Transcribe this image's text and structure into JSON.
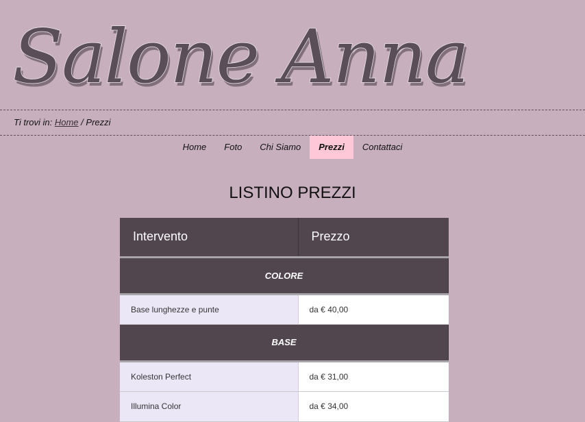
{
  "site": {
    "title": "Salone Anna"
  },
  "breadcrumb": {
    "prefix": "Ti trovi in:",
    "home": "Home",
    "separator": "/",
    "current": "Prezzi"
  },
  "nav": {
    "items": [
      {
        "label": "Home"
      },
      {
        "label": "Foto"
      },
      {
        "label": "Chi Siamo"
      },
      {
        "label": "Prezzi",
        "active": true
      },
      {
        "label": "Contattaci"
      }
    ]
  },
  "page": {
    "title": "LISTINO PREZZI"
  },
  "table": {
    "headers": [
      "Intervento",
      "Prezzo"
    ],
    "sections": [
      {
        "name": "COLORE",
        "items": [
          {
            "name": "Base lunghezze e punte",
            "price": "da € 40,00"
          }
        ]
      },
      {
        "name": "BASE",
        "items": [
          {
            "name": "Koleston Perfect",
            "price": "da € 31,00"
          },
          {
            "name": "Illumina Color",
            "price": "da € 34,00"
          }
        ]
      }
    ]
  },
  "colors": {
    "background": "#c7afbd",
    "header_dark": "#51464e",
    "active_tab": "#ffc8d8",
    "row_light": "#ebe7f7",
    "logo": "#5a4f58"
  }
}
